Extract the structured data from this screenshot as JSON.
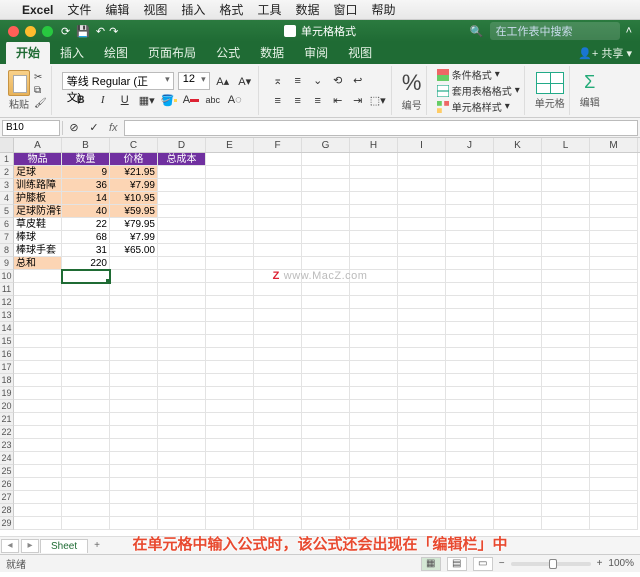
{
  "mac_menu": {
    "app": "Excel",
    "items": [
      "文件",
      "编辑",
      "视图",
      "插入",
      "格式",
      "工具",
      "数据",
      "窗口",
      "帮助"
    ]
  },
  "window": {
    "title": "单元格格式",
    "search_placeholder": "在工作表中搜索"
  },
  "ribbon_tabs": [
    "开始",
    "插入",
    "绘图",
    "页面布局",
    "公式",
    "数据",
    "审阅",
    "视图"
  ],
  "ribbon_share": "共享",
  "ribbon": {
    "paste": "粘贴",
    "font_name": "等线 Regular (正文)",
    "font_size": "12",
    "num_group": "编号",
    "cf": "条件格式",
    "tf": "套用表格格式",
    "cs": "单元格样式",
    "cells": "单元格",
    "edit": "编辑"
  },
  "formula_bar": {
    "name_box": "B10",
    "formula": ""
  },
  "columns": [
    "A",
    "B",
    "C",
    "D",
    "E",
    "F",
    "G",
    "H",
    "I",
    "J",
    "K",
    "L",
    "M"
  ],
  "headers": {
    "a": "物品",
    "b": "数量",
    "c": "价格",
    "d": "总成本"
  },
  "rows": [
    {
      "a": "足球",
      "b": 9,
      "c": "¥21.95",
      "hl": true
    },
    {
      "a": "训练路障",
      "b": 36,
      "c": "¥7.99",
      "hl": true
    },
    {
      "a": "护膝板",
      "b": 14,
      "c": "¥10.95",
      "hl": true
    },
    {
      "a": "足球防滑钉",
      "b": 40,
      "c": "¥59.95",
      "hl": true
    },
    {
      "a": "草皮鞋",
      "b": 22,
      "c": "¥79.95",
      "hl": false
    },
    {
      "a": "棒球",
      "b": 68,
      "c": "¥7.99",
      "hl": false
    },
    {
      "a": "棒球手套",
      "b": 31,
      "c": "¥65.00",
      "hl": false
    }
  ],
  "total": {
    "label": "总和",
    "value": 220
  },
  "watermark": "www.MacZ.com",
  "sheet": {
    "name": "Sheet",
    "status": "就绪",
    "zoom": "100%"
  },
  "caption": "在单元格中输入公式时，该公式还会出现在「编辑栏」中"
}
